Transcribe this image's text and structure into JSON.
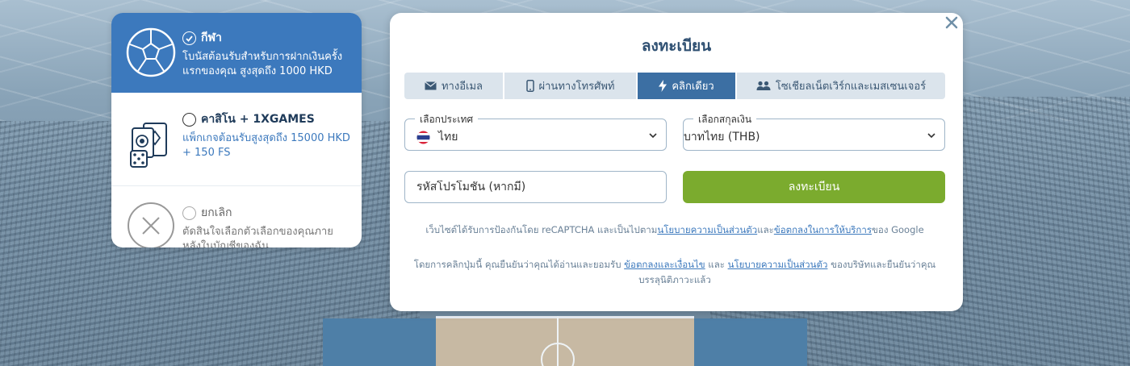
{
  "bonus": {
    "options": [
      {
        "title": "กีฬา",
        "description_line1": "โบนัสต้อนรับสำหรับการฝากเงินครั้ง",
        "description_line2": "แรกของคุณ สูงสุดถึง 1000 HKD",
        "icon": "soccer-ball-icon",
        "selected": true
      },
      {
        "title": "คาสิโน + 1XGAMES",
        "description_line1": "แพ็กเกจต้อนรับสูงสุดถึง 15000 HKD",
        "description_line2": "+ 150 FS",
        "icon": "casino-cards-dice-icon",
        "selected": false
      },
      {
        "title": "ยกเลิก",
        "description_line1": "ตัดสินใจเลือกตัวเลือกของคุณภาย",
        "description_line2": "หลังในบัญชีของฉัน",
        "icon": "cancel-x-icon",
        "selected": false
      }
    ]
  },
  "modal": {
    "title": "ลงทะเบียน",
    "close_icon": "close-icon",
    "tabs": [
      {
        "label": "ทางอีเมล",
        "icon": "envelope-icon",
        "active": false
      },
      {
        "label": "ผ่านทางโทรศัพท์",
        "icon": "phone-icon",
        "active": false
      },
      {
        "label": "คลิกเดียว",
        "icon": "lightning-icon",
        "active": true
      },
      {
        "label": "โซเชียลเน็ตเวิร์กและเมสเซนเจอร์",
        "icon": "users-icon",
        "active": false
      }
    ],
    "country": {
      "label": "เลือกประเทศ",
      "value": "ไทย",
      "flag": "thailand-flag-icon"
    },
    "currency": {
      "label": "เลือกสกุลเงิน",
      "value": "บาทไทย (THB)"
    },
    "promo": {
      "placeholder": "รหัสโปรโมชั่น (หากมี)"
    },
    "submit_label": "ลงทะเบียน",
    "recaptcha_notice": {
      "prefix": "เว็บไซต์ได้รับการป้องกันโดย reCAPTCHA และเป็นไปตาม",
      "privacy_link": "นโยบายความเป็นส่วนตัว",
      "middle": "และ",
      "terms_link": "ข้อตกลงในการให้บริการ",
      "suffix": "ของ Google"
    },
    "agreement_notice": {
      "prefix": "โดยการคลิกปุ่มนี้ คุณยืนยันว่าคุณได้อ่านและยอมรับ ",
      "terms_link": "ข้อตกลงและเงื่อนไข",
      "middle": " และ ",
      "privacy_link": "นโยบายความเป็นส่วนตัว",
      "suffix": " ของบริษัทและยืนยันว่าคุณบรรลุนิติภาวะแล้ว"
    },
    "colors": {
      "primary_blue": "#3c79bd",
      "active_tab": "#3c6fa3",
      "submit_green": "#7bab2e",
      "title_navy": "#2f5072"
    }
  }
}
